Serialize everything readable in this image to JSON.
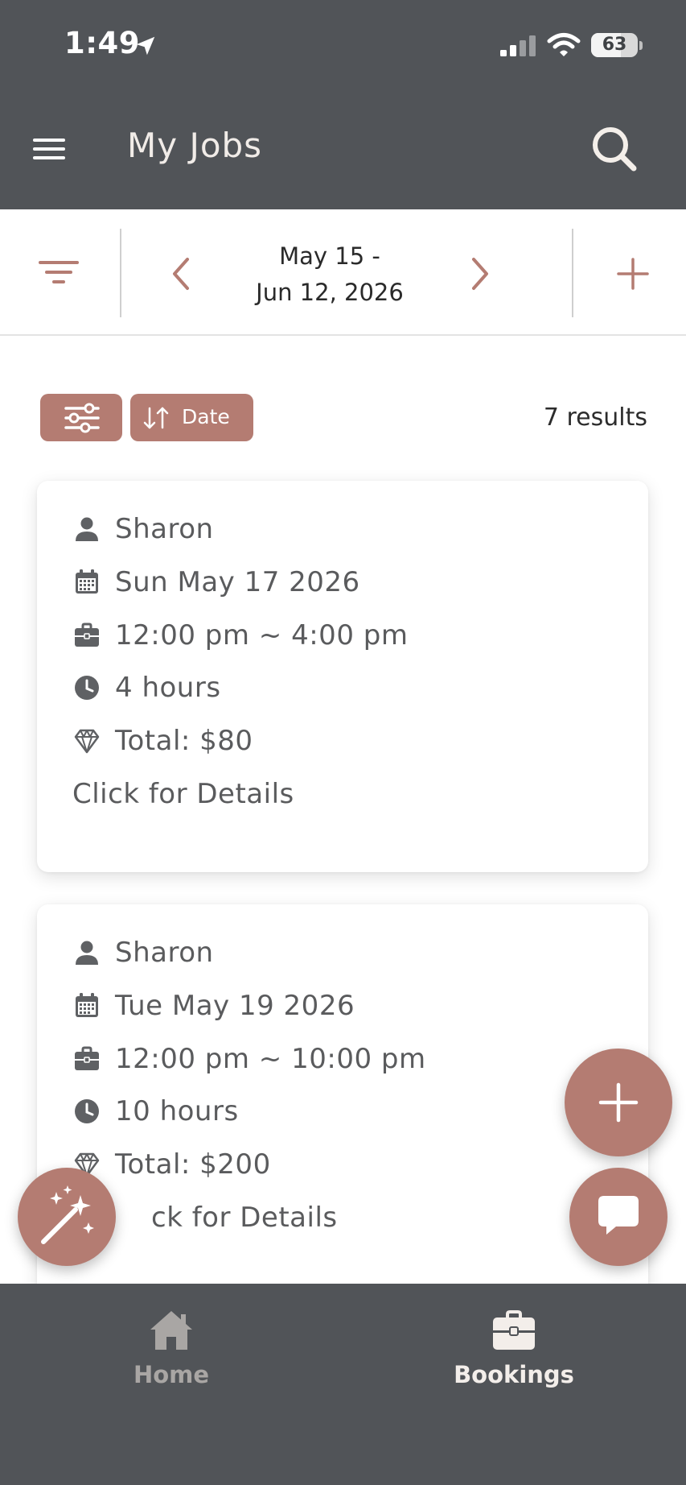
{
  "status_bar": {
    "time": "1:49",
    "battery_level": "63",
    "battery_fraction": 0.63
  },
  "app_bar": {
    "title": "My Jobs"
  },
  "date_nav": {
    "range_line1": "May 15 -",
    "range_line2": "Jun 12, 2026"
  },
  "controls": {
    "sort_label": "Date",
    "results": "7 results"
  },
  "bookings": [
    {
      "client": "Sharon",
      "date": "Sun May 17 2026",
      "time": "12:00 pm ~ 4:00 pm",
      "duration": "4 hours",
      "total": "Total: $80",
      "details": "Click for Details"
    },
    {
      "client": "Sharon",
      "date": "Tue May 19 2026",
      "time": "12:00 pm ~ 10:00 pm",
      "duration": "10 hours",
      "total": "Total: $200",
      "details": "ck for Details"
    }
  ],
  "bottom_nav": {
    "items": [
      {
        "label": "Home",
        "icon": "home-icon",
        "active": false
      },
      {
        "label": "Bookings",
        "icon": "briefcase-icon",
        "active": true
      }
    ]
  },
  "colors": {
    "header_bg": "#515458",
    "accent": "#b47c72",
    "text": "#5a5b5d",
    "active_nav": "#f3eeea",
    "inactive_nav": "#a9a6a4"
  },
  "icons": {
    "status": [
      "location-arrow-icon",
      "signal-icon",
      "wifi-icon",
      "battery-icon"
    ],
    "app_bar": [
      "menu-icon",
      "search-icon"
    ],
    "date_nav": [
      "filter-lines-icon",
      "chevron-left-icon",
      "chevron-right-icon",
      "plus-icon"
    ],
    "card_rows": [
      "person-icon",
      "calendar-icon",
      "briefcase-icon",
      "clock-icon",
      "diamond-icon"
    ],
    "fabs": [
      "plus-icon",
      "chat-icon",
      "magic-wand-icon"
    ]
  }
}
